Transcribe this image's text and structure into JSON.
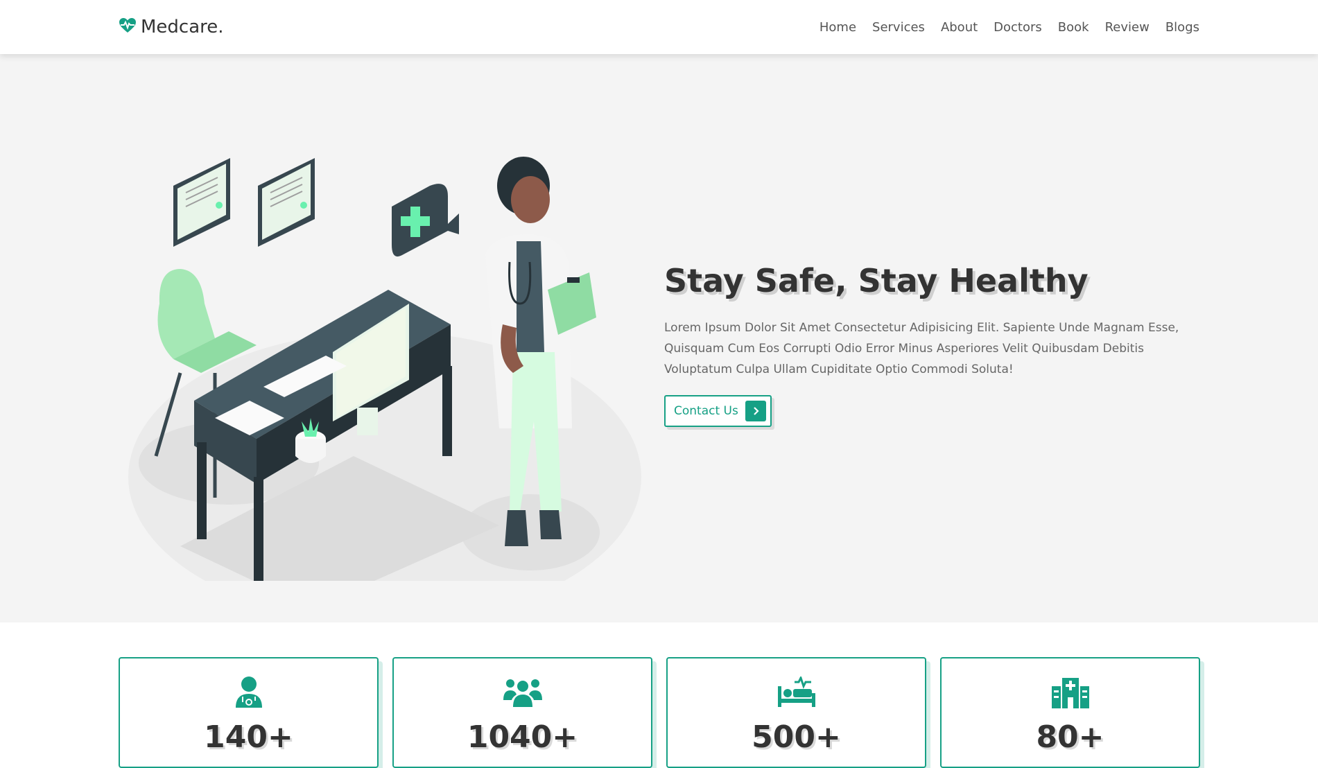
{
  "brand": {
    "name": "Medcare.",
    "icon": "heartbeat-icon",
    "accent": "#16a085"
  },
  "nav": {
    "items": [
      {
        "label": "Home"
      },
      {
        "label": "Services"
      },
      {
        "label": "About"
      },
      {
        "label": "Doctors"
      },
      {
        "label": "Book"
      },
      {
        "label": "Review"
      },
      {
        "label": "Blogs"
      }
    ]
  },
  "hero": {
    "title": "Stay Safe, Stay Healthy",
    "description": "Lorem Ipsum Dolor Sit Amet Consectetur Adipisicing Elit. Sapiente Unde Magnam Esse, Quisquam Cum Eos Corrupti Odio Error Minus Asperiores Velit Quibusdam Debitis Voluptatum Culpa Ullam Cupiditate Optio Commodi Soluta!",
    "button_label": "Contact Us",
    "illustration": "doctor-at-desk-illustration"
  },
  "stats": [
    {
      "icon": "doctor-icon",
      "value": "140+"
    },
    {
      "icon": "users-icon",
      "value": "1040+"
    },
    {
      "icon": "procedures-icon",
      "value": "500+"
    },
    {
      "icon": "hospital-icon",
      "value": "80+"
    }
  ]
}
